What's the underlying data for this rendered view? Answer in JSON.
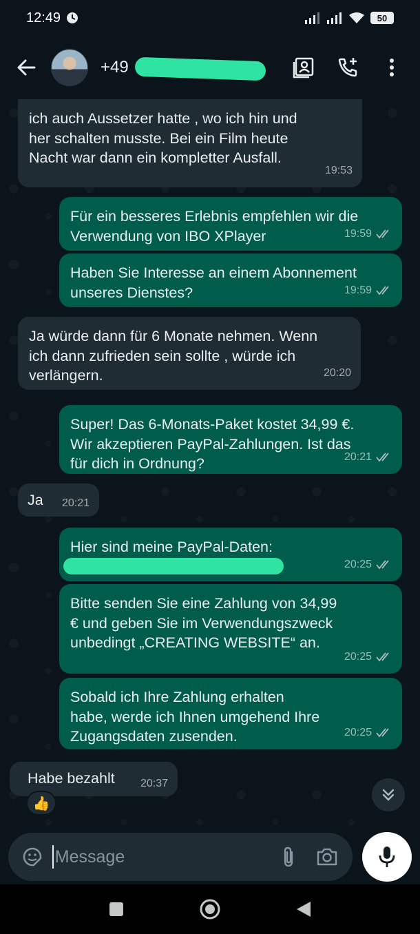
{
  "status_bar": {
    "time": "12:49",
    "battery": "50"
  },
  "header": {
    "contact": "+49"
  },
  "messages": [
    {
      "dir": "in",
      "text": "ich auch Aussetzer hatte , wo ich hin und\nher schalten musste. Bei ein Film heute\nNacht war dann ein kompletter Ausfall.",
      "time": "19:53"
    },
    {
      "dir": "out",
      "text": "Für ein besseres Erlebnis empfehlen wir die\nVerwendung von IBO XPlayer",
      "time": "19:59"
    },
    {
      "dir": "out",
      "text": "Haben Sie Interesse an einem Abonnement\nunseres Dienstes?",
      "time": "19:59"
    },
    {
      "dir": "in",
      "text": "Ja würde dann für 6 Monate nehmen. Wenn\nich dann zufrieden sein sollte , würde ich\nverlängern.",
      "time": "20:20"
    },
    {
      "dir": "out",
      "text": "Super! Das 6-Monats-Paket kostet 34,99 €.\nWir akzeptieren PayPal-Zahlungen. Ist das\nfür dich in Ordnung?",
      "time": "20:21"
    },
    {
      "dir": "in",
      "text": "Ja",
      "time": "20:21"
    },
    {
      "dir": "out",
      "text": "Hier sind meine PayPal-Daten:",
      "time": "20:25"
    },
    {
      "dir": "out",
      "text": "Bitte senden Sie eine Zahlung von 34,99\n€ und geben Sie im Verwendungszweck\nunbedingt „CREATING WEBSITE“ an.",
      "time": "20:25"
    },
    {
      "dir": "out",
      "text": "Sobald ich Ihre Zahlung erhalten\nhabe, werde ich Ihnen umgehend Ihre\nZugangsdaten zusenden.",
      "time": "20:25"
    },
    {
      "dir": "in",
      "text": "Habe bezahlt",
      "time": "20:37",
      "reaction": "👍"
    }
  ],
  "input": {
    "placeholder": "Message"
  },
  "colors": {
    "incoming": "#202c33",
    "outgoing": "#005c4b",
    "accent": "#00a884",
    "background": "#0b141a"
  }
}
